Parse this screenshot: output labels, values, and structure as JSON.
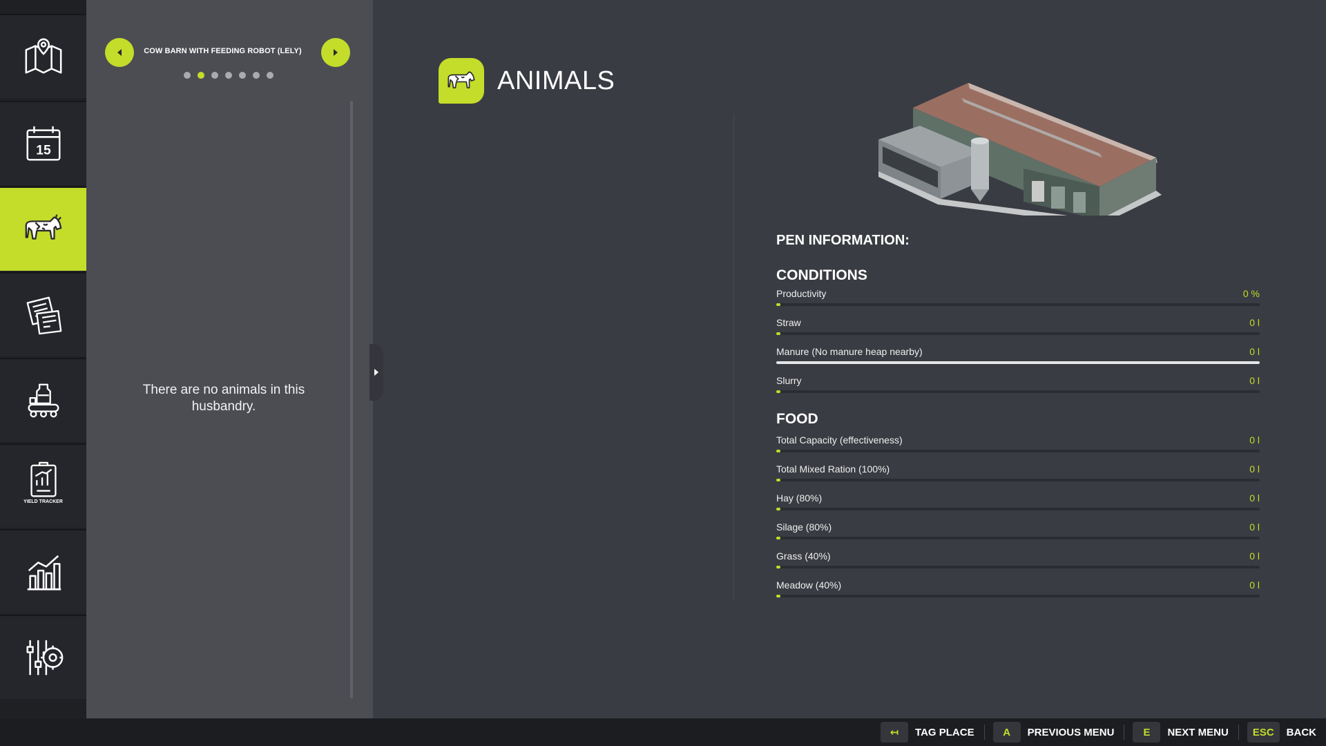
{
  "nav": {
    "items": [
      {
        "name": "map-icon",
        "caption": ""
      },
      {
        "name": "calendar-icon",
        "caption": "15"
      },
      {
        "name": "cow-icon",
        "caption": ""
      },
      {
        "name": "contracts-icon",
        "caption": ""
      },
      {
        "name": "production-icon",
        "caption": ""
      },
      {
        "name": "yield-tracker-icon",
        "caption": "YIELD TRACKER"
      },
      {
        "name": "statistics-icon",
        "caption": ""
      },
      {
        "name": "settings-icon",
        "caption": ""
      }
    ],
    "active_index": 2
  },
  "list_panel": {
    "barn_title": "COW BARN WITH FEEDING ROBOT (LELY)",
    "page_count": 7,
    "current_page": 2,
    "empty_message": "There are no animals in this husbandry."
  },
  "main": {
    "title": "ANIMALS",
    "pen_info_label": "PEN INFORMATION:",
    "conditions_label": "CONDITIONS",
    "food_label": "FOOD",
    "conditions": [
      {
        "label": "Productivity",
        "value": "0 %",
        "level": 0
      },
      {
        "label": "Straw",
        "value": "0 l",
        "level": 0
      },
      {
        "label": "Manure (No manure heap nearby)",
        "value": "0 l",
        "level": 0,
        "disabled": true
      },
      {
        "label": "Slurry",
        "value": "0 l",
        "level": 0
      }
    ],
    "food": [
      {
        "label": "Total Capacity (effectiveness)",
        "value": "0 l",
        "level": 0
      },
      {
        "label": "Total Mixed Ration (100%)",
        "value": "0 l",
        "level": 0
      },
      {
        "label": "Hay (80%)",
        "value": "0 l",
        "level": 0
      },
      {
        "label": "Silage (80%)",
        "value": "0 l",
        "level": 0
      },
      {
        "label": "Grass (40%)",
        "value": "0 l",
        "level": 0
      },
      {
        "label": "Meadow (40%)",
        "value": "0 l",
        "level": 0
      }
    ]
  },
  "footer": {
    "hints": [
      {
        "key": "↤",
        "label": "TAG PLACE"
      },
      {
        "key": "A",
        "label": "PREVIOUS MENU"
      },
      {
        "key": "E",
        "label": "NEXT MENU"
      },
      {
        "key": "ESC",
        "label": "BACK"
      }
    ]
  },
  "colors": {
    "accent": "#c4dd2a",
    "background": "#3a3c43",
    "panel": "#4b4d53",
    "nav": "#25262b"
  }
}
